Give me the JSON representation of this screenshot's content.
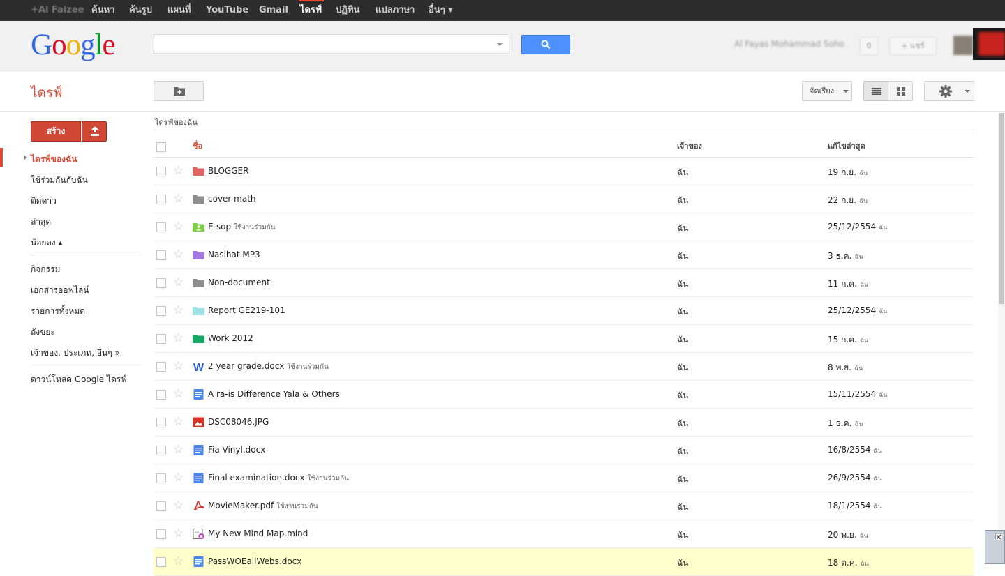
{
  "gbar": {
    "items": [
      {
        "label": "+Al Faizee",
        "blurred": true
      },
      {
        "label": "ค้นหา"
      },
      {
        "label": "ค้นรูป"
      },
      {
        "label": "แผนที่"
      },
      {
        "label": "YouTube"
      },
      {
        "label": "Gmail"
      },
      {
        "label": "ไดรฟ์",
        "active": true
      },
      {
        "label": "ปฏิทิน"
      },
      {
        "label": "แปลภาษา"
      },
      {
        "label": "อื่นๆ ▾"
      }
    ]
  },
  "header": {
    "logo": "Google",
    "search_placeholder": "",
    "user_name": "Al Fayas Mohammad Soho",
    "share_label": "+ แชร์"
  },
  "toolbar": {
    "drive_title": "ไดรฟ์",
    "sort_label": "จัดเรียง"
  },
  "sidebar": {
    "create_label": "สร้าง",
    "items": [
      {
        "label": "ไดรฟ์ของฉัน",
        "active": true
      },
      {
        "label": "ใช้ร่วมกันกับฉัน"
      },
      {
        "label": "ติดดาว"
      },
      {
        "label": "ล่าสุด"
      },
      {
        "label": "น้อยลง ▴"
      },
      {
        "label": "กิจกรรม"
      },
      {
        "label": "เอกสารออฟไลน์"
      },
      {
        "label": "รายการทั้งหมด"
      },
      {
        "label": "ถังขยะ"
      },
      {
        "label": "เจ้าของ, ประเภท, อื่นๆ »"
      },
      {
        "label": "ดาวน์โหลด Google ไดรฟ์"
      }
    ]
  },
  "list": {
    "breadcrumb": "ไดรฟ์ของฉัน",
    "columns": {
      "name": "ชื่อ",
      "owner": "เจ้าของ",
      "modified": "แก้ไขล่าสุด"
    },
    "rows": [
      {
        "name": "BLOGGER",
        "shared": "",
        "owner": "ฉัน",
        "modified": "19 ก.ย.",
        "by": "ฉัน",
        "icon": "folder-icon",
        "color": "#e06666"
      },
      {
        "name": "cover math",
        "shared": "",
        "owner": "ฉัน",
        "modified": "22 ก.ย.",
        "by": "ฉัน",
        "icon": "folder-icon",
        "color": "#8f8f8f"
      },
      {
        "name": "E-sop",
        "shared": "ใช้งานร่วมกัน",
        "owner": "ฉัน",
        "modified": "25/12/2554",
        "by": "ฉัน",
        "icon": "shared-folder-icon",
        "color": "#7bd148"
      },
      {
        "name": "Nasihat.MP3",
        "shared": "",
        "owner": "ฉัน",
        "modified": "3 ธ.ค.",
        "by": "ฉัน",
        "icon": "folder-icon",
        "color": "#a479e2"
      },
      {
        "name": "Non-document",
        "shared": "",
        "owner": "ฉัน",
        "modified": "11 ก.ค.",
        "by": "ฉัน",
        "icon": "folder-icon",
        "color": "#8f8f8f"
      },
      {
        "name": "Report GE219-101",
        "shared": "",
        "owner": "ฉัน",
        "modified": "25/12/2554",
        "by": "ฉัน",
        "icon": "folder-icon",
        "color": "#9fe1e7"
      },
      {
        "name": "Work 2012",
        "shared": "",
        "owner": "ฉัน",
        "modified": "15 ก.ค.",
        "by": "ฉัน",
        "icon": "folder-icon",
        "color": "#16a765"
      },
      {
        "name": "2 year grade.docx",
        "shared": "ใช้งานร่วมกัน",
        "owner": "ฉัน",
        "modified": "8 พ.ย.",
        "by": "ฉัน",
        "icon": "word-icon",
        "color": "#2a5bd7"
      },
      {
        "name": "A ra-is Difference Yala & Others",
        "shared": "",
        "owner": "ฉัน",
        "modified": "15/11/2554",
        "by": "ฉัน",
        "icon": "doc-icon",
        "color": "#4a86e8"
      },
      {
        "name": "DSC08046.JPG",
        "shared": "",
        "owner": "ฉัน",
        "modified": "1 ธ.ค.",
        "by": "ฉัน",
        "icon": "image-icon",
        "color": "#d93025"
      },
      {
        "name": "Fia Vinyl.docx",
        "shared": "",
        "owner": "ฉัน",
        "modified": "16/8/2554",
        "by": "ฉัน",
        "icon": "doc-icon",
        "color": "#4a86e8"
      },
      {
        "name": "Final examination.docx",
        "shared": "ใช้งานร่วมกัน",
        "owner": "ฉัน",
        "modified": "26/9/2554",
        "by": "ฉัน",
        "icon": "doc-icon",
        "color": "#4a86e8"
      },
      {
        "name": "MovieMaker.pdf",
        "shared": "ใช้งานร่วมกัน",
        "owner": "ฉัน",
        "modified": "18/1/2554",
        "by": "ฉัน",
        "icon": "pdf-icon",
        "color": "#d93025"
      },
      {
        "name": "My New Mind Map.mind",
        "shared": "",
        "owner": "ฉัน",
        "modified": "20 พ.ย.",
        "by": "ฉัน",
        "icon": "mindmap-icon",
        "color": "#c040c0"
      },
      {
        "name": "PassWOEallWebs.docx",
        "shared": "",
        "owner": "ฉัน",
        "modified": "18 ต.ค.",
        "by": "ฉัน",
        "icon": "doc-icon",
        "color": "#4a86e8",
        "selected": true
      }
    ]
  }
}
